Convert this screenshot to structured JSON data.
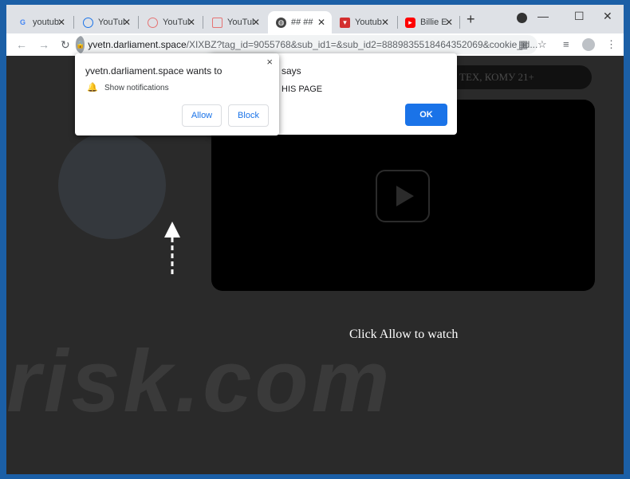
{
  "tabs": [
    {
      "label": "youtub",
      "icon": "google-icon"
    },
    {
      "label": "YouTul",
      "icon": "download-icon"
    },
    {
      "label": "YouTul",
      "icon": "target-icon"
    },
    {
      "label": "YouTul",
      "icon": "youtube-outline-icon"
    },
    {
      "label": "## ##",
      "icon": "globe-icon",
      "active": true
    },
    {
      "label": "Youtub",
      "icon": "red-shield-icon"
    },
    {
      "label": "Billie E",
      "icon": "youtube-icon"
    }
  ],
  "address": {
    "host": "yvetn.darliament.space",
    "path": "/XIXBZ?tag_id=9055768&sub_id1=&sub_id2=8889835518464352069&cookie_id..."
  },
  "notification": {
    "title": "yvetn.darliament.space wants to",
    "item": "Show notifications",
    "allow": "Allow",
    "block": "Block",
    "close": "×"
  },
  "alert": {
    "says": "says",
    "message": "HIS PAGE",
    "ok": "OK"
  },
  "page": {
    "age_banner": "ТЕХ, КОМУ 21+",
    "cta": "Click Allow to watch",
    "watermark": "risk.com"
  },
  "colors": {
    "accent": "#1a73e8",
    "frame": "#1b5fa6"
  }
}
